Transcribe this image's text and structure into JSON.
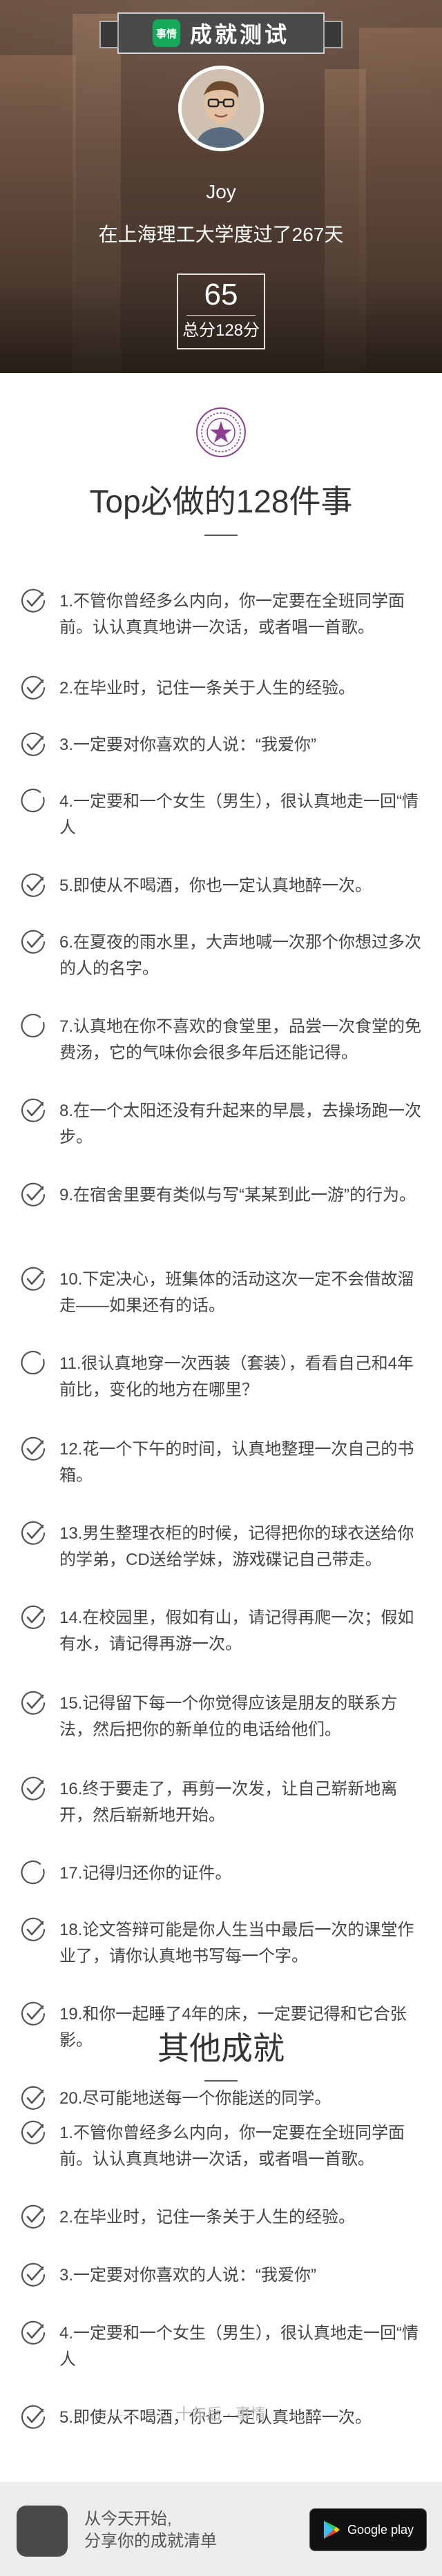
{
  "header": {
    "logo_text": "事情",
    "title": "成就测试",
    "user_name": "Joy",
    "school_line": "在上海理工大学度过了267天",
    "score": "65",
    "total_label": "总分128分"
  },
  "sections": [
    {
      "title": "Top必做的128件事",
      "items": [
        {
          "text": "1.不管你曾经多么内向，你一定要在全班同学面前。认认真真地讲一次话，或者唱一首歌。",
          "checked": true
        },
        {
          "text": "2.在毕业时，记住一条关于人生的经验。",
          "checked": true
        },
        {
          "text": "3.一定要对你喜欢的人说：“我爱你”",
          "checked": true
        },
        {
          "text": "4.一定要和一个女生（男生），很认真地走一回“情人",
          "checked": false
        },
        {
          "text": "5.即使从不喝酒，你也一定认真地醉一次。",
          "checked": true
        },
        {
          "text": "6.在夏夜的雨水里，大声地喊一次那个你想过多次的人的名字。",
          "checked": true
        },
        {
          "text": "7.认真地在你不喜欢的食堂里，品尝一次食堂的免费汤，它的气味你会很多年后还能记得。",
          "checked": false
        },
        {
          "text": "8.在一个太阳还没有升起来的早晨，去操场跑一次步。",
          "checked": true
        },
        {
          "text": "9.在宿舍里要有类似与写“某某到此一游”的行为。",
          "checked": true
        },
        {
          "text": "10.下定决心，班集体的活动这次一定不会借故溜走——如果还有的话。",
          "checked": true
        },
        {
          "text": "11.很认真地穿一次西装（套装），看看自己和4年前比，变化的地方在哪里？",
          "checked": false
        },
        {
          "text": "12.花一个下午的时间，认真地整理一次自己的书箱。",
          "checked": true
        },
        {
          "text": "13.男生整理衣柜的时候，记得把你的球衣送给你的学弟，CD送给学妹，游戏碟记自己带走。",
          "checked": true
        },
        {
          "text": "14.在校园里，假如有山，请记得再爬一次；假如有水，请记得再游一次。",
          "checked": true
        },
        {
          "text": "15.记得留下每一个你觉得应该是朋友的联系方法，然后把你的新单位的电话给他们。",
          "checked": true
        },
        {
          "text": "16.终于要走了，再剪一次发，让自己崭新地离开，然后崭新地开始。",
          "checked": true
        },
        {
          "text": "17.记得归还你的证件。",
          "checked": false
        },
        {
          "text": "18.论文答辩可能是你人生当中最后一次的课堂作业了，请你认真地书写每一个字。",
          "checked": true
        },
        {
          "text": "19.和你一起睡了4年的床，一定要记得和它合张影。",
          "checked": true
        },
        {
          "text": "20.尽可能地送每一个你能送的同学。",
          "checked": true
        }
      ]
    },
    {
      "title": "其他成就",
      "items": [
        {
          "text": "1.不管你曾经多么内向，你一定要在全班同学面前。认认真真地讲一次话，或者唱一首歌。",
          "checked": true
        },
        {
          "text": "2.在毕业时，记住一条关于人生的经验。",
          "checked": true
        },
        {
          "text": "3.一定要对你喜欢的人说：“我爱你”",
          "checked": true
        },
        {
          "text": "4.一定要和一个女生（男生），很认真地走一回“情人",
          "checked": true
        },
        {
          "text": "5.即使从不喝酒，你也一定认真地醉一次。",
          "checked": true
        }
      ]
    }
  ],
  "footer": {
    "brand_line": "十年后 · 事情",
    "cta_line1": "从今天开始,",
    "cta_line2": "分享你的成就清单",
    "store_label": "Google play"
  },
  "colors": {
    "check": "#555555",
    "title_banner": "#4a4a4a",
    "logo_green": "#14a85a"
  }
}
